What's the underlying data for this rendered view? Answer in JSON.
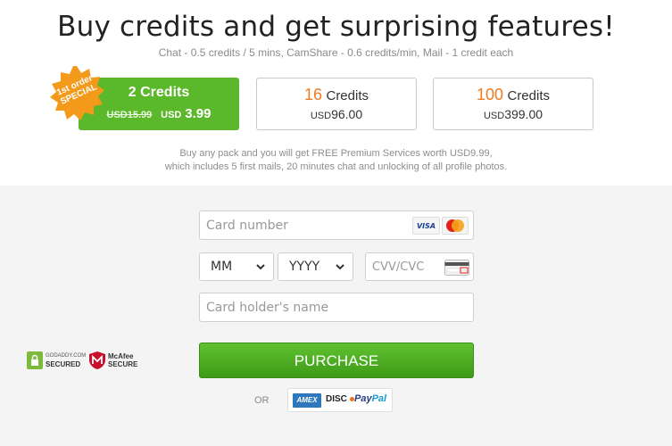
{
  "header": {
    "title": "Buy credits and get surprising features!",
    "subtitle": "Chat - 0.5 credits / 5 mins, CamShare - 0.6 credits/min, Mail - 1 credit each"
  },
  "badge": {
    "line1": "1st order",
    "line2": "SPECIAL"
  },
  "packs": [
    {
      "credits_num": "2",
      "credits_word": "Credits",
      "old_price": "USD15.99",
      "currency": "USD",
      "price": "3.99",
      "selected": true
    },
    {
      "credits_num": "16",
      "credits_word": "Credits",
      "currency": "USD",
      "price": "96.00",
      "selected": false
    },
    {
      "credits_num": "100",
      "credits_word": "Credits",
      "currency": "USD",
      "price": "399.00",
      "selected": false
    }
  ],
  "note": {
    "line1": "Buy any pack and you will get FREE Premium Services worth USD9.99,",
    "line2": "which includes 5 first mails, 20 minutes chat and unlocking of all profile photos."
  },
  "form": {
    "card_number_placeholder": "Card number",
    "month_value": "MM",
    "year_value": "YYYY",
    "cvv_placeholder": "CVV/CVC",
    "holder_placeholder": "Card holder's name",
    "purchase_label": "PURCHASE",
    "or_label": "OR"
  },
  "card_logos": {
    "visa": "VISA",
    "mastercard": "MasterCard",
    "amex": "AMEX",
    "discover": "DISC",
    "paypal_pay": "Pay",
    "paypal_pal": "Pal"
  },
  "trust": {
    "godaddy_line1": "GODADDY.COM",
    "godaddy_line2": "SECURED",
    "mcafee_line1": "McAfee",
    "mcafee_line2": "SECURE"
  },
  "colors": {
    "accent_green": "#5cb82b",
    "accent_orange": "#f07b1f",
    "badge_orange": "#f39a1a"
  }
}
